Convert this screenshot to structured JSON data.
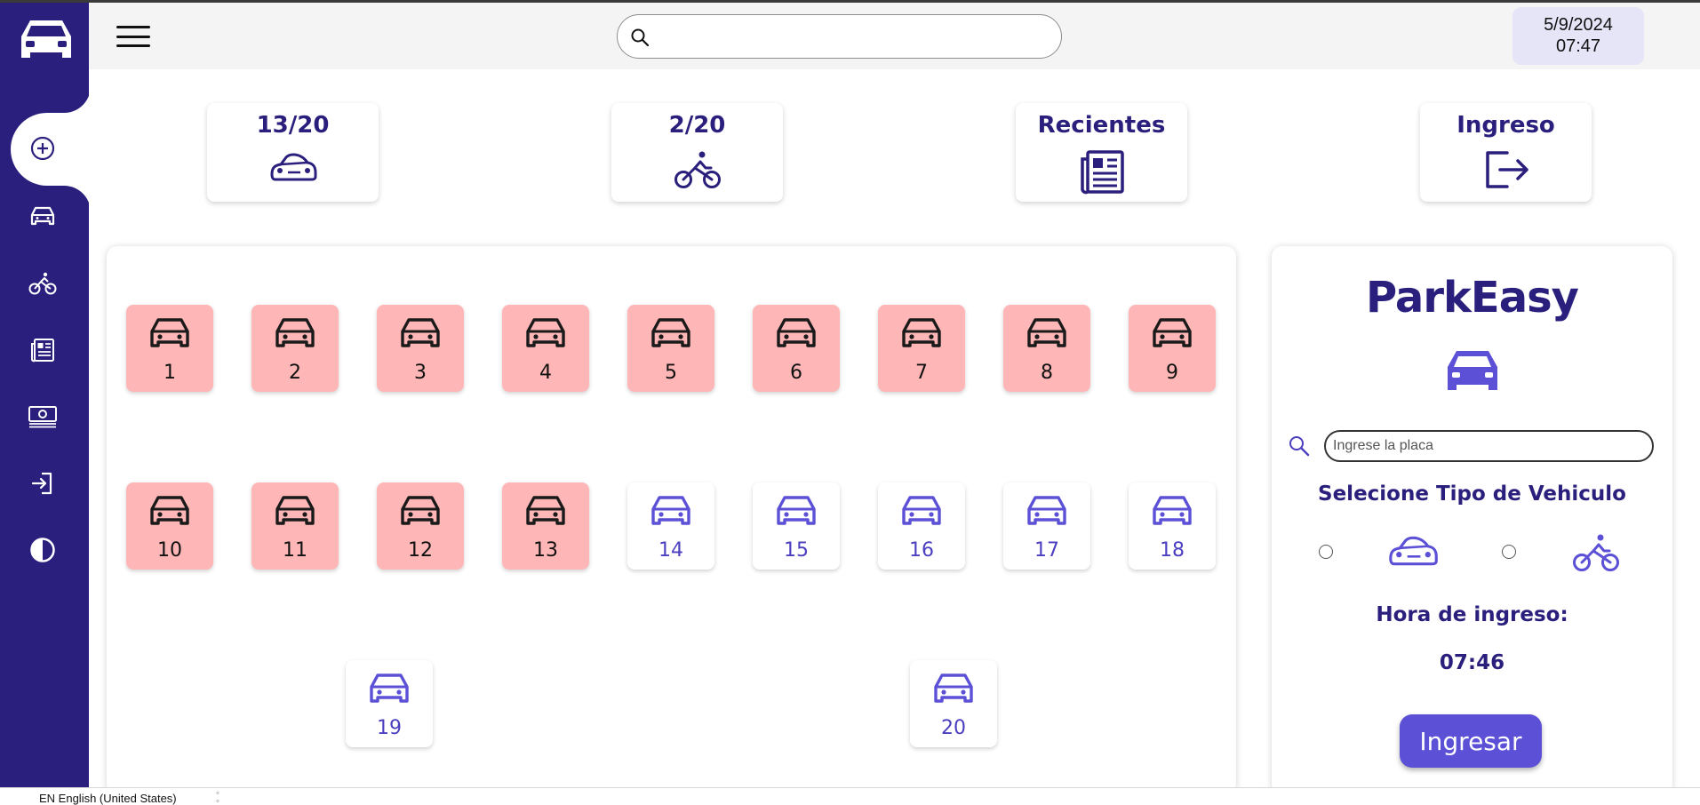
{
  "header": {
    "search_placeholder": "",
    "date": "5/9/2024",
    "time": "07:47"
  },
  "sidebar": {
    "items": [
      {
        "icon": "add-circle-icon",
        "active": true
      },
      {
        "icon": "car-icon"
      },
      {
        "icon": "bike-icon"
      },
      {
        "icon": "newspaper-icon"
      },
      {
        "icon": "money-icon"
      },
      {
        "icon": "login-icon"
      },
      {
        "icon": "contrast-icon"
      }
    ]
  },
  "stats": [
    {
      "label": "13/20",
      "icon": "car-icon"
    },
    {
      "label": "2/20",
      "icon": "bike-icon"
    },
    {
      "label": "Recientes",
      "icon": "newspaper-icon"
    },
    {
      "label": "Ingreso",
      "icon": "logout-icon"
    }
  ],
  "slots": [
    {
      "number": "1",
      "occupied": true
    },
    {
      "number": "2",
      "occupied": true
    },
    {
      "number": "3",
      "occupied": true
    },
    {
      "number": "4",
      "occupied": true
    },
    {
      "number": "5",
      "occupied": true
    },
    {
      "number": "6",
      "occupied": true
    },
    {
      "number": "7",
      "occupied": true
    },
    {
      "number": "8",
      "occupied": true
    },
    {
      "number": "9",
      "occupied": true
    },
    {
      "number": "10",
      "occupied": true
    },
    {
      "number": "11",
      "occupied": true
    },
    {
      "number": "12",
      "occupied": true
    },
    {
      "number": "13",
      "occupied": true
    },
    {
      "number": "14",
      "occupied": false
    },
    {
      "number": "15",
      "occupied": false
    },
    {
      "number": "16",
      "occupied": false
    },
    {
      "number": "17",
      "occupied": false
    },
    {
      "number": "18",
      "occupied": false
    },
    {
      "number": "19",
      "occupied": false
    },
    {
      "number": "20",
      "occupied": false
    }
  ],
  "entry": {
    "brand": "ParkEasy",
    "plate_placeholder": "Ingrese la placa",
    "select_title": "Selecione Tipo de Vehiculo",
    "hora_label": "Hora de ingreso:",
    "hora_value": "07:46",
    "submit_label": "Ingresar"
  },
  "taskbar": {
    "language": "EN English (United States)"
  },
  "colors": {
    "sidebar": "#2a1f7c",
    "accent": "#5b50d6",
    "occupied": "#ffb6b6",
    "brand_text": "#2a1f7c"
  }
}
